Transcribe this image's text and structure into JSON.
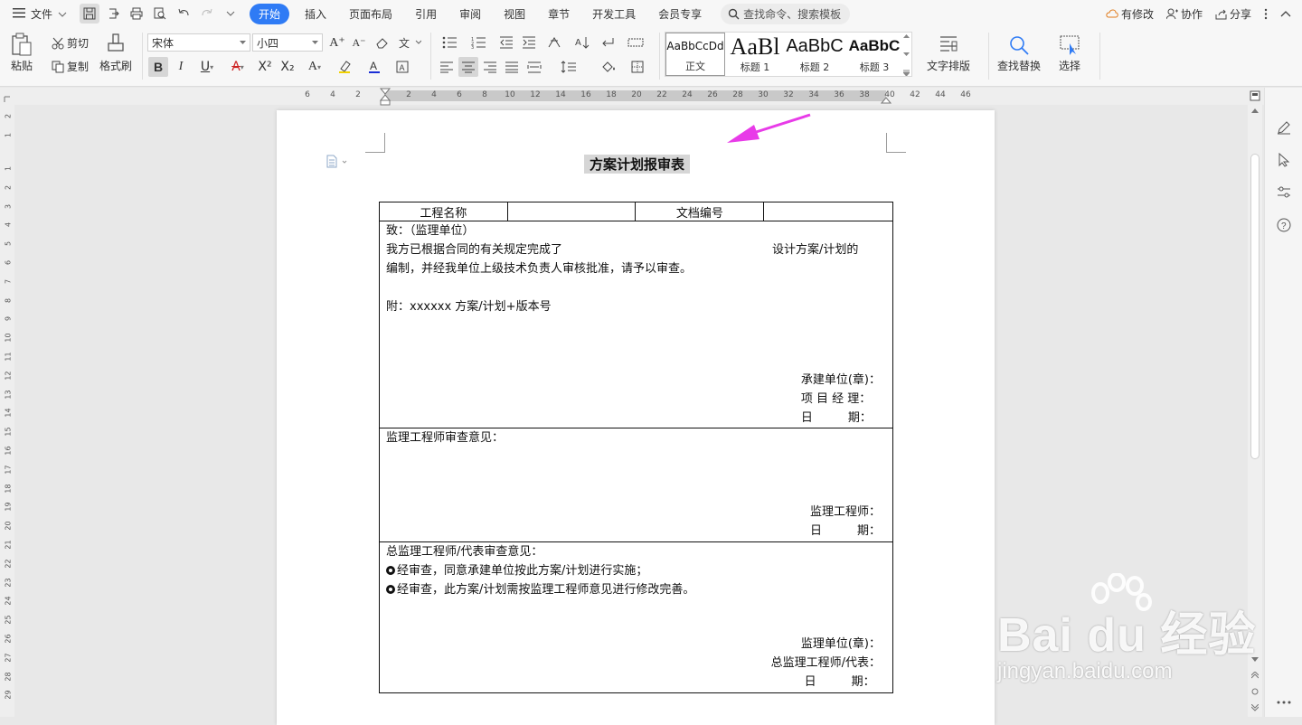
{
  "menubar": {
    "file_label": "文件",
    "tabs": [
      "开始",
      "插入",
      "页面布局",
      "引用",
      "审阅",
      "视图",
      "章节",
      "开发工具",
      "会员专享"
    ],
    "active_tab": "开始",
    "search_placeholder": "查找命令、搜索模板",
    "right": {
      "modified": "有修改",
      "collab": "协作",
      "share": "分享"
    }
  },
  "ribbon": {
    "paste": "粘贴",
    "cut": "剪切",
    "copy": "复制",
    "format_painter": "格式刷",
    "font_name": "宋体",
    "font_size": "小四",
    "styles": [
      {
        "preview": "AaBbCcDd",
        "caption": "正文"
      },
      {
        "preview": "AaBl",
        "caption": "标题 1"
      },
      {
        "preview": "AaBbC",
        "caption": "标题 2"
      },
      {
        "preview": "AaBbC",
        "caption": "标题 3"
      }
    ],
    "text_layout": "文字排版",
    "find_replace": "查找替换",
    "select": "选择"
  },
  "ruler": {
    "h_ticks": [
      "6",
      "4",
      "2",
      "2",
      "4",
      "6",
      "8",
      "10",
      "12",
      "14",
      "16",
      "18",
      "20",
      "22",
      "24",
      "26",
      "28",
      "30",
      "32",
      "34",
      "36",
      "38",
      "40",
      "42",
      "44",
      "46"
    ],
    "v_ticks": [
      "2",
      "1",
      "1",
      "2",
      "3",
      "4",
      "5",
      "6",
      "7",
      "8",
      "9",
      "10",
      "11",
      "12",
      "13",
      "14",
      "15",
      "16",
      "17",
      "18",
      "19",
      "20",
      "21",
      "22",
      "23",
      "24",
      "25",
      "26",
      "27",
      "28",
      "29"
    ]
  },
  "document": {
    "title": "方案计划报审表",
    "header": {
      "project_name_label": "工程名称",
      "doc_number_label": "文档编号"
    },
    "section1": {
      "to": "致：（监理单位）",
      "line1_left": "我方已根据合同的有关规定完成了",
      "line1_right": "设计方案/计划的",
      "line2": "编制，并经我单位上级技术负责人审核批准，请予以审查。",
      "attachment": "附：xxxxxx 方案/计划+版本号",
      "sign1": "承建单位(章)：",
      "sign2": "项 目 经 理：",
      "sign3": "日　　　期："
    },
    "section2": {
      "heading": "监理工程师审查意见：",
      "sign1": "监理工程师：",
      "sign2": "日　　　期："
    },
    "section3": {
      "heading": "总监理工程师/代表审查意见：",
      "opt1": "经审查，同意承建单位按此方案/计划进行实施；",
      "opt2": "经审查，此方案/计划需按监理工程师意见进行修改完善。",
      "sign1": "监理单位(章)：",
      "sign2": "总监理工程师/代表：",
      "sign3": "日　　　期："
    }
  },
  "watermark": {
    "brand": "Bai du 经验",
    "url": "jingyan.baidu.com"
  },
  "colors": {
    "accent": "#2f7bf5",
    "arrow": "#e83be8"
  }
}
